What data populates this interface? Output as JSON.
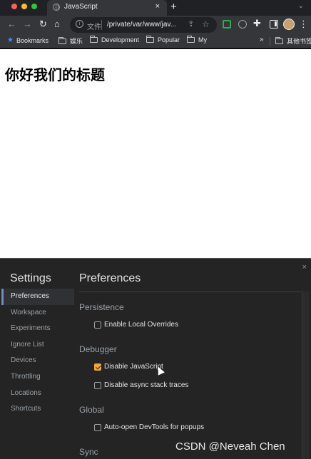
{
  "browser": {
    "tab_title": "JavaScript",
    "tab_close": "×",
    "new_tab": "+",
    "tab_menu": "⌄",
    "omnibox": {
      "scheme_label": "文件",
      "url": "/private/var/www/jav..."
    },
    "icons": [
      "back-icon",
      "forward-icon",
      "reload-icon",
      "home-icon",
      "info-icon",
      "share-icon",
      "bookmark-star-icon",
      "extension-green-icon",
      "extension-grey-icon",
      "puzzle-icon",
      "sidepanel-icon",
      "kebab-menu-icon"
    ],
    "bookmarks": {
      "items": [
        "Bookmarks",
        "娱乐",
        "Development",
        "Popular",
        "My"
      ],
      "overflow": "»",
      "other": "其他书签"
    }
  },
  "page": {
    "heading": "你好我们的标题"
  },
  "devtools": {
    "close": "×",
    "settings_title": "Settings",
    "nav_items": [
      "Preferences",
      "Workspace",
      "Experiments",
      "Ignore List",
      "Devices",
      "Throttling",
      "Locations",
      "Shortcuts"
    ],
    "active_nav_index": 0,
    "panel_title": "Preferences",
    "sections": {
      "persistence": {
        "title": "Persistence",
        "options": [
          {
            "label": "Enable Local Overrides",
            "checked": false
          }
        ]
      },
      "debugger": {
        "title": "Debugger",
        "options": [
          {
            "label": "Disable JavaScript",
            "checked": true
          },
          {
            "label": "Disable async stack traces",
            "checked": false
          }
        ]
      },
      "global": {
        "title": "Global",
        "options": [
          {
            "label": "Auto-open DevTools for popups",
            "checked": false
          }
        ]
      },
      "sync": {
        "title": "Sync"
      }
    },
    "accent_color": "#f1a83a"
  },
  "watermark": "CSDN @Neveah  Chen"
}
